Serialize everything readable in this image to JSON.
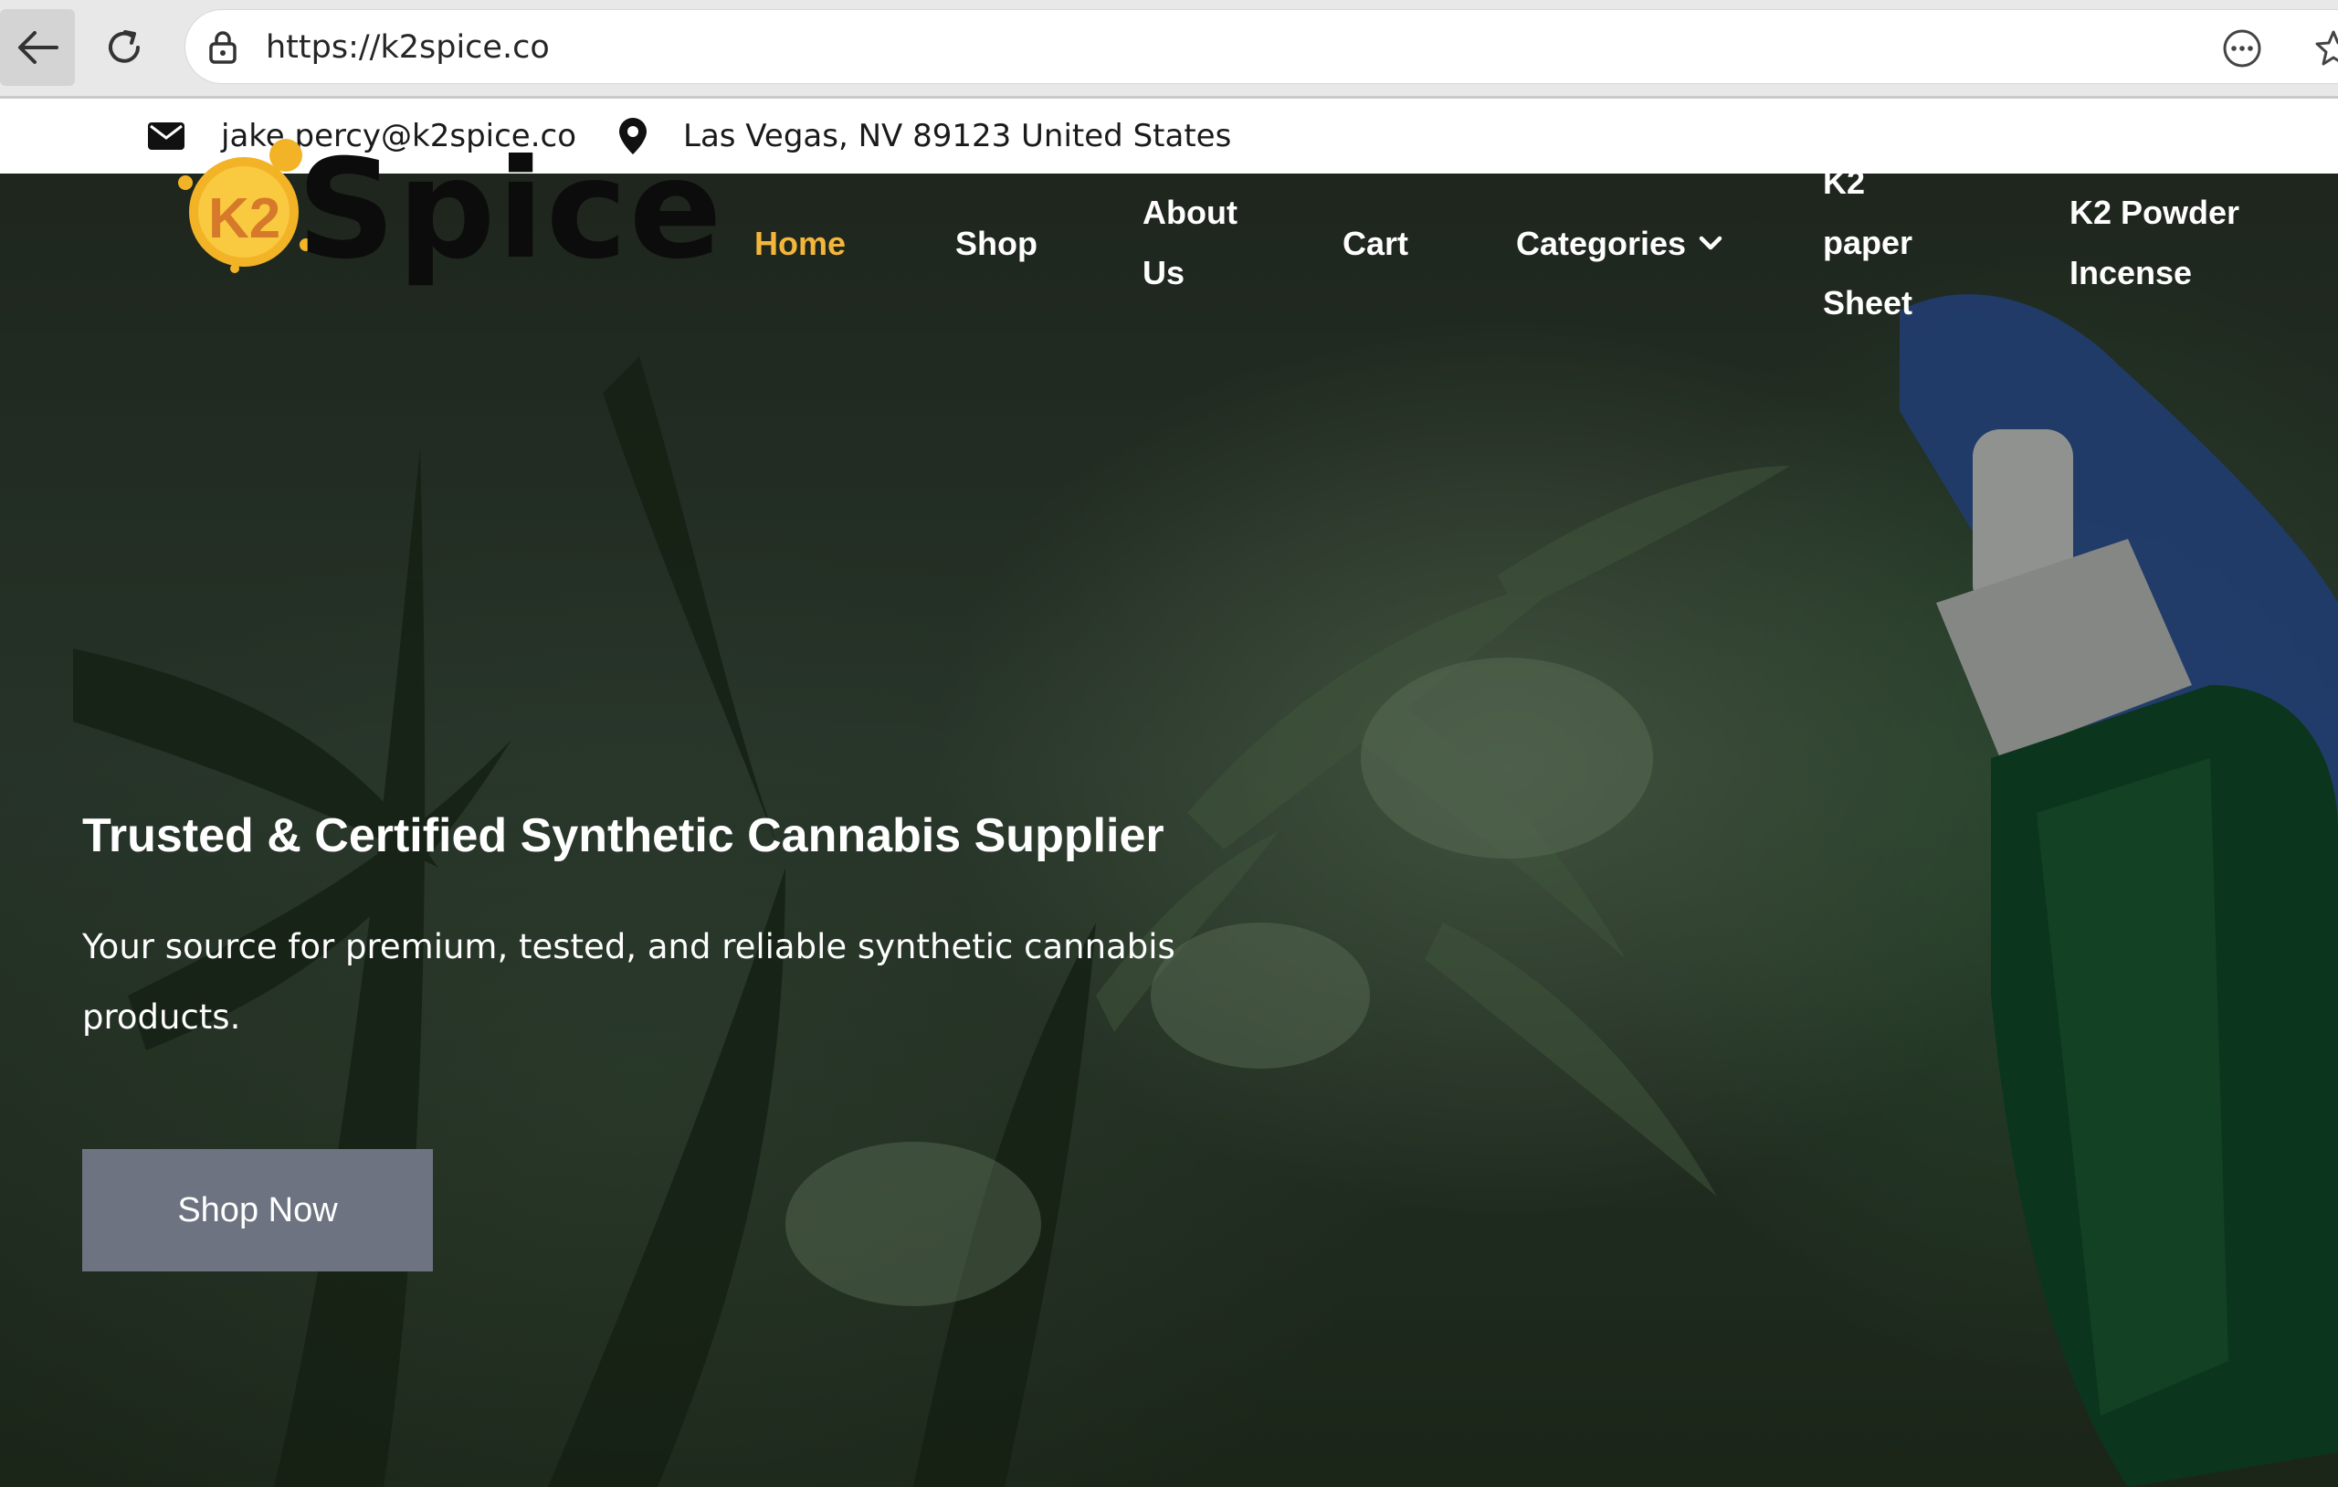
{
  "browser": {
    "url": "https://k2spice.co"
  },
  "contact": {
    "email": "jake.percy@k2spice.co",
    "address": "Las Vegas, NV 89123 United States"
  },
  "logo": {
    "badge_text": "K2",
    "word": "Spice"
  },
  "nav": {
    "home": "Home",
    "shop": "Shop",
    "about_line1": "About",
    "about_line2": "Us",
    "cart": "Cart",
    "categories": "Categories",
    "k2paper_line1": "K2",
    "k2paper_line2": "paper",
    "k2paper_line3": "Sheet",
    "powder_line1": "K2 Powder",
    "powder_line2": "Incense"
  },
  "hero": {
    "title": "Trusted & Certified Synthetic Cannabis Supplier",
    "subtitle": "Your source for premium, tested, and reliable synthetic cannabis products.",
    "cta": "Shop Now"
  },
  "colors": {
    "accent": "#f3b63b",
    "button": "#6d7380"
  },
  "icons": {
    "back": "back-arrow-icon",
    "reload": "reload-icon",
    "lock": "lock-icon",
    "more": "more-options-icon",
    "favorite": "favorite-star-icon",
    "email": "envelope-icon",
    "location": "map-pin-icon",
    "dropdown": "chevron-down-icon"
  }
}
